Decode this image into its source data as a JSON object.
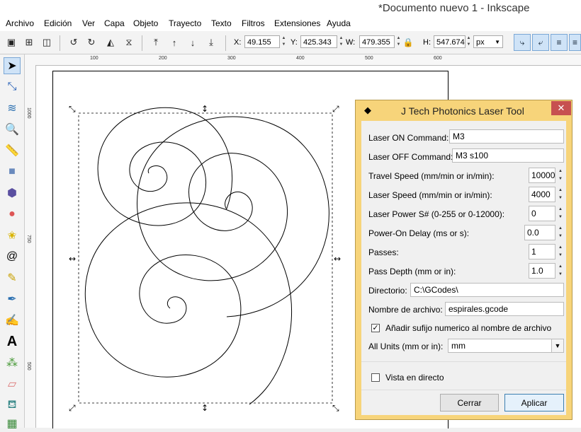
{
  "window": {
    "title": "*Documento nuevo 1 - Inkscape"
  },
  "menu": [
    "Archivo",
    "Edición",
    "Ver",
    "Capa",
    "Objeto",
    "Trayecto",
    "Texto",
    "Filtros",
    "Extensiones",
    "Ayuda"
  ],
  "toolbar": {
    "x_label": "X:",
    "x_value": "49.155",
    "y_label": "Y:",
    "y_value": "425.343",
    "w_label": "W:",
    "w_value": "479.355",
    "h_label": "H:",
    "h_value": "547.674",
    "unit": "px"
  },
  "rulers": {
    "h_ticks": [
      "100",
      "200",
      "300",
      "400",
      "500",
      "600"
    ],
    "v_ticks": [
      "1000",
      "750",
      "500"
    ]
  },
  "dialog": {
    "title": "J Tech Photonics Laser Tool",
    "close": "✕",
    "fields": [
      {
        "label": "Laser ON Command:",
        "value": "M3"
      },
      {
        "label": "Laser OFF Command:",
        "value": "M3 s100"
      },
      {
        "label": "Travel Speed (mm/min or in/min):",
        "value": "10000"
      },
      {
        "label": "Laser Speed (mm/min or in/min):",
        "value": "4000"
      },
      {
        "label": "Laser Power S# (0-255 or 0-12000):",
        "value": "0"
      },
      {
        "label": "Power-On Delay (ms or s):",
        "value": "0.0"
      },
      {
        "label": "Passes:",
        "value": "1"
      },
      {
        "label": "Pass Depth (mm or in):",
        "value": "1.0"
      },
      {
        "label": "Directorio:",
        "value": "C:\\GCodes\\"
      },
      {
        "label": "Nombre de archivo:",
        "value": "espirales.gcode"
      }
    ],
    "suffix_checkbox": {
      "label": "Añadir sufijo numerico al nombre de archivo",
      "checked": true
    },
    "units": {
      "label": "All Units (mm or in):",
      "value": "mm"
    },
    "live_preview": {
      "label": "Vista en directo",
      "checked": false
    },
    "cancel": "Cerrar",
    "apply": "Aplicar"
  }
}
